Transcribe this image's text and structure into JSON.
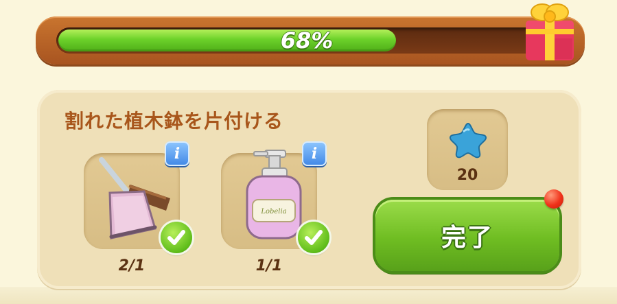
{
  "progress": {
    "percent_label": "68%",
    "value": 0.68
  },
  "task": {
    "title": "割れた植木鉢を片付ける",
    "items": [
      {
        "name": "ほうきとちりとり",
        "count": "2/1",
        "info_label": "i",
        "done": true
      },
      {
        "name": "ソープボトル",
        "count": "1/1",
        "info_label": "i",
        "done": true
      }
    ],
    "reward": {
      "icon": "blue-star-icon",
      "amount": "20"
    },
    "complete_button_label": "完了"
  },
  "colors": {
    "accent_green": "#6fbd22",
    "frame_brown": "#b8642a",
    "title_brown": "#a8561b",
    "info_blue": "#3f87e5",
    "notify_red": "#f0321a"
  }
}
